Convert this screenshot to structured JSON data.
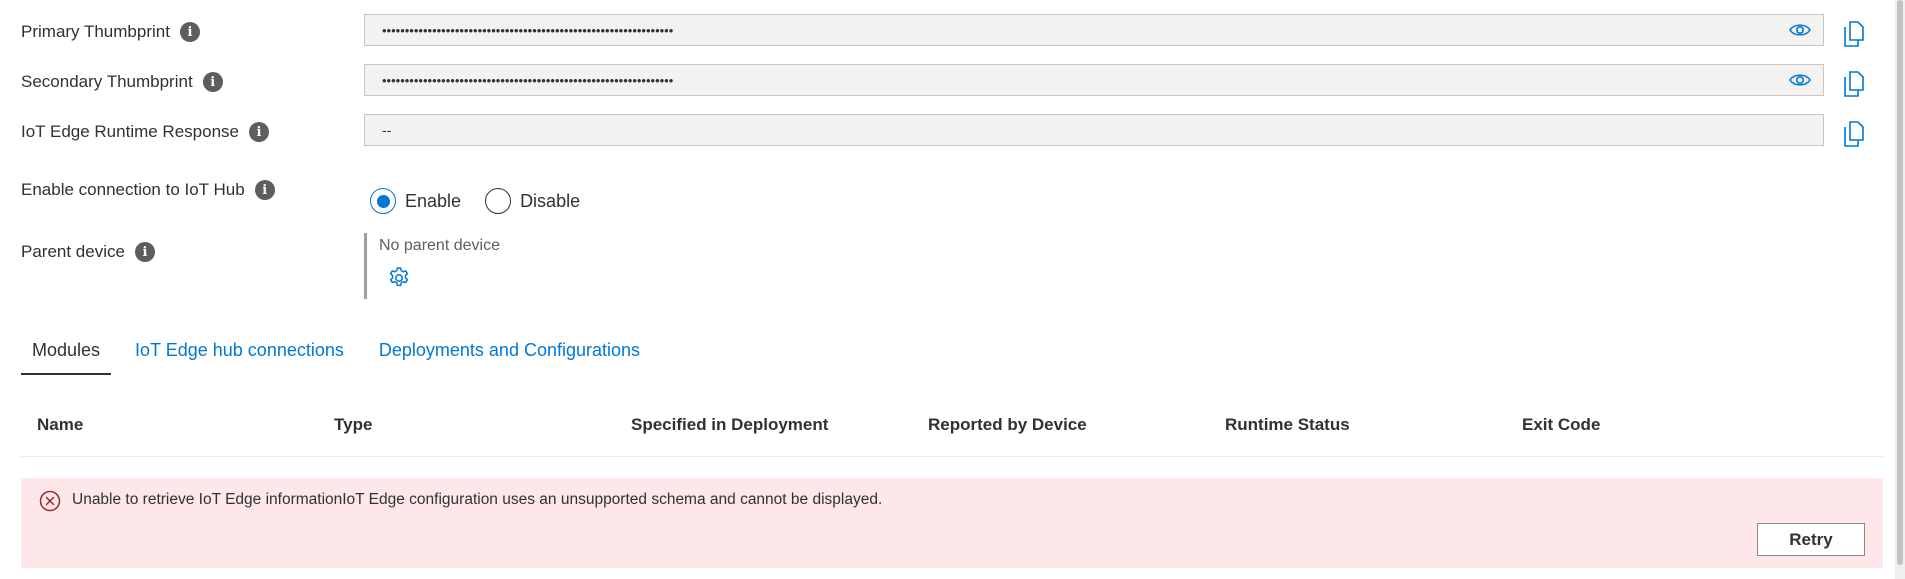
{
  "form": {
    "primary_thumbprint": {
      "label": "Primary Thumbprint",
      "value": "••••••••••••••••••••••••••••••••••••••••••••••••••••••••••••••••"
    },
    "secondary_thumbprint": {
      "label": "Secondary Thumbprint",
      "value": "••••••••••••••••••••••••••••••••••••••••••••••••••••••••••••••••"
    },
    "runtime_response": {
      "label": "IoT Edge Runtime Response",
      "value": "--"
    },
    "connection": {
      "label": "Enable connection to IoT Hub",
      "enable_label": "Enable",
      "disable_label": "Disable",
      "selected": "Enable"
    },
    "parent_device": {
      "label": "Parent device",
      "value": "No parent device"
    }
  },
  "info_glyph": "i",
  "tabs": [
    {
      "label": "Modules",
      "active": true
    },
    {
      "label": "IoT Edge hub connections",
      "active": false
    },
    {
      "label": "Deployments and Configurations",
      "active": false
    }
  ],
  "table": {
    "columns": [
      "Name",
      "Type",
      "Specified in Deployment",
      "Reported by Device",
      "Runtime Status",
      "Exit Code"
    ]
  },
  "error": {
    "message": "Unable to retrieve IoT Edge informationIoT Edge configuration uses an unsupported schema and cannot be displayed.",
    "retry_label": "Retry"
  },
  "colors": {
    "accent": "#0078d4",
    "error_bg": "#fde7e9",
    "error_icon": "#a4262c"
  },
  "icons": [
    "info-icon",
    "eye-icon",
    "copy-icon",
    "gear-icon",
    "error-circle-icon"
  ]
}
